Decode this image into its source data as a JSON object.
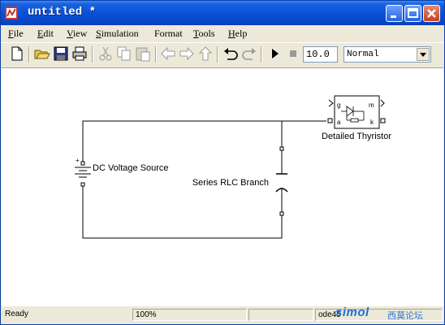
{
  "window": {
    "title": "untitled *"
  },
  "menu": {
    "items": [
      {
        "mn": "F",
        "rest": "ile"
      },
      {
        "mn": "E",
        "rest": "dit"
      },
      {
        "mn": "V",
        "rest": "iew"
      },
      {
        "mn": "S",
        "rest": "imulation"
      },
      {
        "mn": "",
        "rest": "Format"
      },
      {
        "mn": "T",
        "rest": "ools"
      },
      {
        "mn": "H",
        "rest": "elp"
      }
    ]
  },
  "toolbar": {
    "icons": [
      "new-file-icon",
      "open-folder-icon",
      "save-icon",
      "print-icon",
      "cut-icon",
      "copy-icon",
      "paste-icon",
      "back-arrow-icon",
      "forward-arrow-icon",
      "up-arrow-icon",
      "undo-icon",
      "redo-icon",
      "run-icon",
      "stop-icon"
    ],
    "stop_time": "10.0",
    "sim_mode": "Normal"
  },
  "diagram": {
    "blocks": {
      "thyristor": "Detailed Thyristor",
      "dc_source": "DC Voltage Source",
      "rlc": "Series RLC Branch",
      "thy_ports": {
        "g": "g",
        "m": "m",
        "a": "a",
        "k": "k"
      },
      "dc_plus": "+"
    }
  },
  "status": {
    "ready": "Ready",
    "zoom": "100%",
    "solver": "ode45"
  },
  "watermark": {
    "logo": "simol",
    "text": "西莫论坛"
  },
  "colors": {
    "title_bar": "#0a50d8",
    "chrome": "#ece9d8",
    "canvas": "#ffffff"
  }
}
